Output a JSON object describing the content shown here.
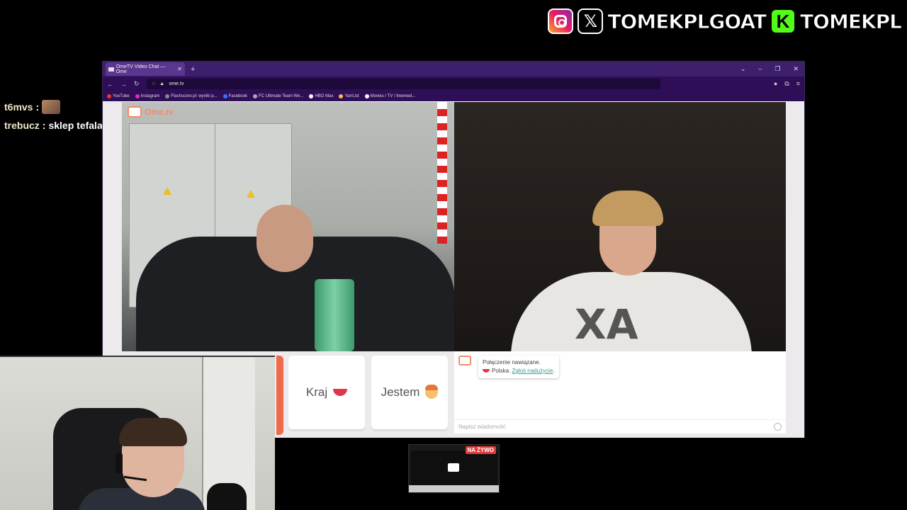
{
  "social": {
    "handle_main": "TOMEKPLGOAT",
    "handle_kick": "TOMEKPL",
    "icons": [
      "instagram-icon",
      "x-icon",
      "kick-icon"
    ],
    "x_glyph": "𝕏",
    "kick_glyph": "K"
  },
  "chat": {
    "messages": [
      {
        "user": "t6mvs",
        "text": ""
      },
      {
        "user": "trebucz",
        "text": "sklep tefala"
      }
    ]
  },
  "browser": {
    "tab_title": "OmeTV Video Chat — Ome",
    "url": "ome.tv",
    "bookmarks": [
      "YouTube",
      "Instagram",
      "Flashscore.pl: wyniki p...",
      "Facebook",
      "FC Ultimate Team We...",
      "HBO Max",
      "YarrList",
      "Movies / TV / freemed..."
    ]
  },
  "ome": {
    "logo": "Ome.tv",
    "btn_country": "Kraj",
    "btn_iam": "Jestem",
    "status_line1": "Połączenie nawiązane.",
    "status_country": "Polska.",
    "report_link": "Zgłoś nadużycie",
    "input_placeholder": "Napisz wiadomość",
    "shirt_text": "XA"
  },
  "live": {
    "badge": "NA ŻYWO"
  },
  "colors": {
    "browser_chrome": "#2e0f57",
    "ome_accent": "#f28b6a",
    "live_red": "#e23b3b"
  }
}
